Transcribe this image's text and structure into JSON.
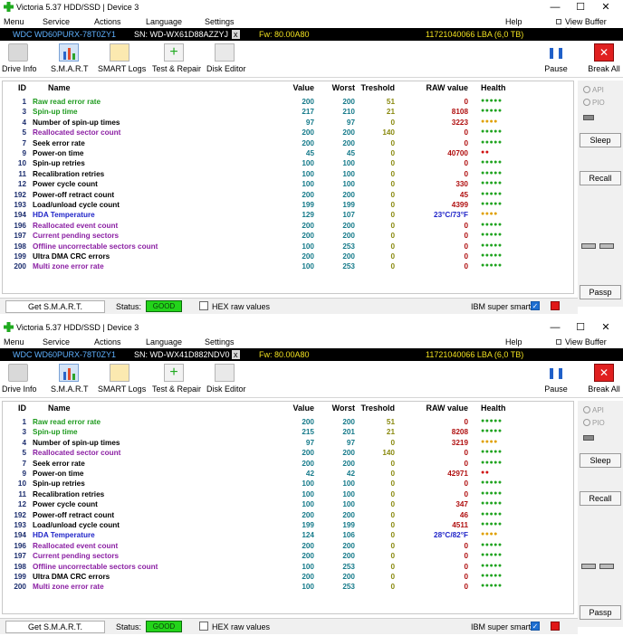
{
  "colors": {
    "name_green": "#1f9b1f",
    "name_black": "#000000",
    "name_purple": "#8b1fa3",
    "name_blue": "#1f24c8",
    "health_green": "#1fa31f",
    "health_yellow": "#e0a000",
    "health_red": "#d01010",
    "raw_red": "#b01010",
    "raw_blue": "#1f24c8",
    "devbar_blue": "#5fb1ff",
    "devbar_white": "#ffffff",
    "devbar_yellow": "#f0e020"
  },
  "windows": [
    {
      "title": "Victoria 5.37 HDD/SSD | Device 3",
      "menu": {
        "menu": "Menu",
        "service": "Service",
        "actions": "Actions",
        "language": "Language",
        "settings": "Settings",
        "help": "Help",
        "view_buffer": "View Buffer Live"
      },
      "device": {
        "model": "WDC WD60PURX-78T0ZY1",
        "serial": "SN: WD-WX61D88AZZYJ",
        "close": "x",
        "firmware": "Fw: 80.00A80",
        "capacity": "11721040066 LBA (6,0 TB)"
      },
      "toolbar": {
        "drive_info": "Drive Info",
        "smart": "S.M.A.R.T",
        "smart_logs": "SMART Logs",
        "test_repair": "Test & Repair",
        "disk_editor": "Disk Editor",
        "pause": "Pause",
        "break_all": "Break All"
      },
      "columns": {
        "id": "ID",
        "name": "Name",
        "value": "Value",
        "worst": "Worst",
        "treshold": "Treshold",
        "raw": "RAW value",
        "health": "Health"
      },
      "rows": [
        {
          "id": "1",
          "name": "Raw read error rate",
          "value": "200",
          "worst": "200",
          "treshold": "51",
          "raw": "0",
          "health": "●●●●●",
          "name_color": "green",
          "health_color": "green",
          "raw_color": "red"
        },
        {
          "id": "3",
          "name": "Spin-up time",
          "value": "217",
          "worst": "210",
          "treshold": "21",
          "raw": "8108",
          "health": "●●●●●",
          "name_color": "green",
          "health_color": "green",
          "raw_color": "red"
        },
        {
          "id": "4",
          "name": "Number of spin-up times",
          "value": "97",
          "worst": "97",
          "treshold": "0",
          "raw": "3223",
          "health": "●●●●",
          "name_color": "black",
          "health_color": "yellow",
          "raw_color": "red"
        },
        {
          "id": "5",
          "name": "Reallocated sector count",
          "value": "200",
          "worst": "200",
          "treshold": "140",
          "raw": "0",
          "health": "●●●●●",
          "name_color": "purple",
          "health_color": "green",
          "raw_color": "red"
        },
        {
          "id": "7",
          "name": "Seek error rate",
          "value": "200",
          "worst": "200",
          "treshold": "0",
          "raw": "0",
          "health": "●●●●●",
          "name_color": "black",
          "health_color": "green",
          "raw_color": "red"
        },
        {
          "id": "9",
          "name": "Power-on time",
          "value": "45",
          "worst": "45",
          "treshold": "0",
          "raw": "40700",
          "health": "●●",
          "name_color": "black",
          "health_color": "red",
          "raw_color": "red"
        },
        {
          "id": "10",
          "name": "Spin-up retries",
          "value": "100",
          "worst": "100",
          "treshold": "0",
          "raw": "0",
          "health": "●●●●●",
          "name_color": "black",
          "health_color": "green",
          "raw_color": "red"
        },
        {
          "id": "11",
          "name": "Recalibration retries",
          "value": "100",
          "worst": "100",
          "treshold": "0",
          "raw": "0",
          "health": "●●●●●",
          "name_color": "black",
          "health_color": "green",
          "raw_color": "red"
        },
        {
          "id": "12",
          "name": "Power cycle count",
          "value": "100",
          "worst": "100",
          "treshold": "0",
          "raw": "330",
          "health": "●●●●●",
          "name_color": "black",
          "health_color": "green",
          "raw_color": "red"
        },
        {
          "id": "192",
          "name": "Power-off retract count",
          "value": "200",
          "worst": "200",
          "treshold": "0",
          "raw": "45",
          "health": "●●●●●",
          "name_color": "black",
          "health_color": "green",
          "raw_color": "red"
        },
        {
          "id": "193",
          "name": "Load/unload cycle count",
          "value": "199",
          "worst": "199",
          "treshold": "0",
          "raw": "4399",
          "health": "●●●●●",
          "name_color": "black",
          "health_color": "green",
          "raw_color": "red"
        },
        {
          "id": "194",
          "name": "HDA Temperature",
          "value": "129",
          "worst": "107",
          "treshold": "0",
          "raw": "23°C/73°F",
          "health": "●●●●",
          "name_color": "blue",
          "health_color": "yellow",
          "raw_color": "blue"
        },
        {
          "id": "196",
          "name": "Reallocated event count",
          "value": "200",
          "worst": "200",
          "treshold": "0",
          "raw": "0",
          "health": "●●●●●",
          "name_color": "purple",
          "health_color": "green",
          "raw_color": "red"
        },
        {
          "id": "197",
          "name": "Current pending sectors",
          "value": "200",
          "worst": "200",
          "treshold": "0",
          "raw": "0",
          "health": "●●●●●",
          "name_color": "purple",
          "health_color": "green",
          "raw_color": "red"
        },
        {
          "id": "198",
          "name": "Offline uncorrectable sectors count",
          "value": "100",
          "worst": "253",
          "treshold": "0",
          "raw": "0",
          "health": "●●●●●",
          "name_color": "purple",
          "health_color": "green",
          "raw_color": "red"
        },
        {
          "id": "199",
          "name": "Ultra DMA CRC errors",
          "value": "200",
          "worst": "200",
          "treshold": "0",
          "raw": "0",
          "health": "●●●●●",
          "name_color": "black",
          "health_color": "green",
          "raw_color": "red"
        },
        {
          "id": "200",
          "name": "Multi zone error rate",
          "value": "100",
          "worst": "253",
          "treshold": "0",
          "raw": "0",
          "health": "●●●●●",
          "name_color": "purple",
          "health_color": "green",
          "raw_color": "red"
        }
      ],
      "side": {
        "api": "API",
        "pio": "PIO",
        "sleep": "Sleep",
        "recall": "Recall",
        "passp": "Passp"
      },
      "status": {
        "get_smart": "Get S.M.A.R.T.",
        "status_label": "Status:",
        "status_value": "GOOD",
        "hex_raw": "HEX raw values",
        "ibm_super_smart": "IBM super smart:",
        "ibm_check": "✓"
      }
    },
    {
      "title": "Victoria 5.37 HDD/SSD | Device 3",
      "menu": {
        "menu": "Menu",
        "service": "Service",
        "actions": "Actions",
        "language": "Language",
        "settings": "Settings",
        "help": "Help",
        "view_buffer": "View Buffer Live"
      },
      "device": {
        "model": "WDC WD60PURX-78T0ZY1",
        "serial": "SN: WD-WX41D882NDV0",
        "close": "x",
        "firmware": "Fw: 80.00A80",
        "capacity": "11721040066 LBA (6,0 TB)"
      },
      "toolbar": {
        "drive_info": "Drive Info",
        "smart": "S.M.A.R.T",
        "smart_logs": "SMART Logs",
        "test_repair": "Test & Repair",
        "disk_editor": "Disk Editor",
        "pause": "Pause",
        "break_all": "Break All"
      },
      "columns": {
        "id": "ID",
        "name": "Name",
        "value": "Value",
        "worst": "Worst",
        "treshold": "Treshold",
        "raw": "RAW value",
        "health": "Health"
      },
      "rows": [
        {
          "id": "1",
          "name": "Raw read error rate",
          "value": "200",
          "worst": "200",
          "treshold": "51",
          "raw": "0",
          "health": "●●●●●",
          "name_color": "green",
          "health_color": "green",
          "raw_color": "red"
        },
        {
          "id": "3",
          "name": "Spin-up time",
          "value": "215",
          "worst": "201",
          "treshold": "21",
          "raw": "8208",
          "health": "●●●●●",
          "name_color": "green",
          "health_color": "green",
          "raw_color": "red"
        },
        {
          "id": "4",
          "name": "Number of spin-up times",
          "value": "97",
          "worst": "97",
          "treshold": "0",
          "raw": "3219",
          "health": "●●●●",
          "name_color": "black",
          "health_color": "yellow",
          "raw_color": "red"
        },
        {
          "id": "5",
          "name": "Reallocated sector count",
          "value": "200",
          "worst": "200",
          "treshold": "140",
          "raw": "0",
          "health": "●●●●●",
          "name_color": "purple",
          "health_color": "green",
          "raw_color": "red"
        },
        {
          "id": "7",
          "name": "Seek error rate",
          "value": "200",
          "worst": "200",
          "treshold": "0",
          "raw": "0",
          "health": "●●●●●",
          "name_color": "black",
          "health_color": "green",
          "raw_color": "red"
        },
        {
          "id": "9",
          "name": "Power-on time",
          "value": "42",
          "worst": "42",
          "treshold": "0",
          "raw": "42971",
          "health": "●●",
          "name_color": "black",
          "health_color": "red",
          "raw_color": "red"
        },
        {
          "id": "10",
          "name": "Spin-up retries",
          "value": "100",
          "worst": "100",
          "treshold": "0",
          "raw": "0",
          "health": "●●●●●",
          "name_color": "black",
          "health_color": "green",
          "raw_color": "red"
        },
        {
          "id": "11",
          "name": "Recalibration retries",
          "value": "100",
          "worst": "100",
          "treshold": "0",
          "raw": "0",
          "health": "●●●●●",
          "name_color": "black",
          "health_color": "green",
          "raw_color": "red"
        },
        {
          "id": "12",
          "name": "Power cycle count",
          "value": "100",
          "worst": "100",
          "treshold": "0",
          "raw": "347",
          "health": "●●●●●",
          "name_color": "black",
          "health_color": "green",
          "raw_color": "red"
        },
        {
          "id": "192",
          "name": "Power-off retract count",
          "value": "200",
          "worst": "200",
          "treshold": "0",
          "raw": "46",
          "health": "●●●●●",
          "name_color": "black",
          "health_color": "green",
          "raw_color": "red"
        },
        {
          "id": "193",
          "name": "Load/unload cycle count",
          "value": "199",
          "worst": "199",
          "treshold": "0",
          "raw": "4511",
          "health": "●●●●●",
          "name_color": "black",
          "health_color": "green",
          "raw_color": "red"
        },
        {
          "id": "194",
          "name": "HDA Temperature",
          "value": "124",
          "worst": "106",
          "treshold": "0",
          "raw": "28°C/82°F",
          "health": "●●●●",
          "name_color": "blue",
          "health_color": "yellow",
          "raw_color": "blue"
        },
        {
          "id": "196",
          "name": "Reallocated event count",
          "value": "200",
          "worst": "200",
          "treshold": "0",
          "raw": "0",
          "health": "●●●●●",
          "name_color": "purple",
          "health_color": "green",
          "raw_color": "red"
        },
        {
          "id": "197",
          "name": "Current pending sectors",
          "value": "200",
          "worst": "200",
          "treshold": "0",
          "raw": "0",
          "health": "●●●●●",
          "name_color": "purple",
          "health_color": "green",
          "raw_color": "red"
        },
        {
          "id": "198",
          "name": "Offline uncorrectable sectors count",
          "value": "100",
          "worst": "253",
          "treshold": "0",
          "raw": "0",
          "health": "●●●●●",
          "name_color": "purple",
          "health_color": "green",
          "raw_color": "red"
        },
        {
          "id": "199",
          "name": "Ultra DMA CRC errors",
          "value": "200",
          "worst": "200",
          "treshold": "0",
          "raw": "0",
          "health": "●●●●●",
          "name_color": "black",
          "health_color": "green",
          "raw_color": "red"
        },
        {
          "id": "200",
          "name": "Multi zone error rate",
          "value": "100",
          "worst": "253",
          "treshold": "0",
          "raw": "0",
          "health": "●●●●●",
          "name_color": "purple",
          "health_color": "green",
          "raw_color": "red"
        }
      ],
      "side": {
        "api": "API",
        "pio": "PIO",
        "sleep": "Sleep",
        "recall": "Recall",
        "passp": "Passp"
      },
      "status": {
        "get_smart": "Get S.M.A.R.T.",
        "status_label": "Status:",
        "status_value": "GOOD",
        "hex_raw": "HEX raw values",
        "ibm_super_smart": "IBM super smart:",
        "ibm_check": "✓"
      }
    }
  ]
}
